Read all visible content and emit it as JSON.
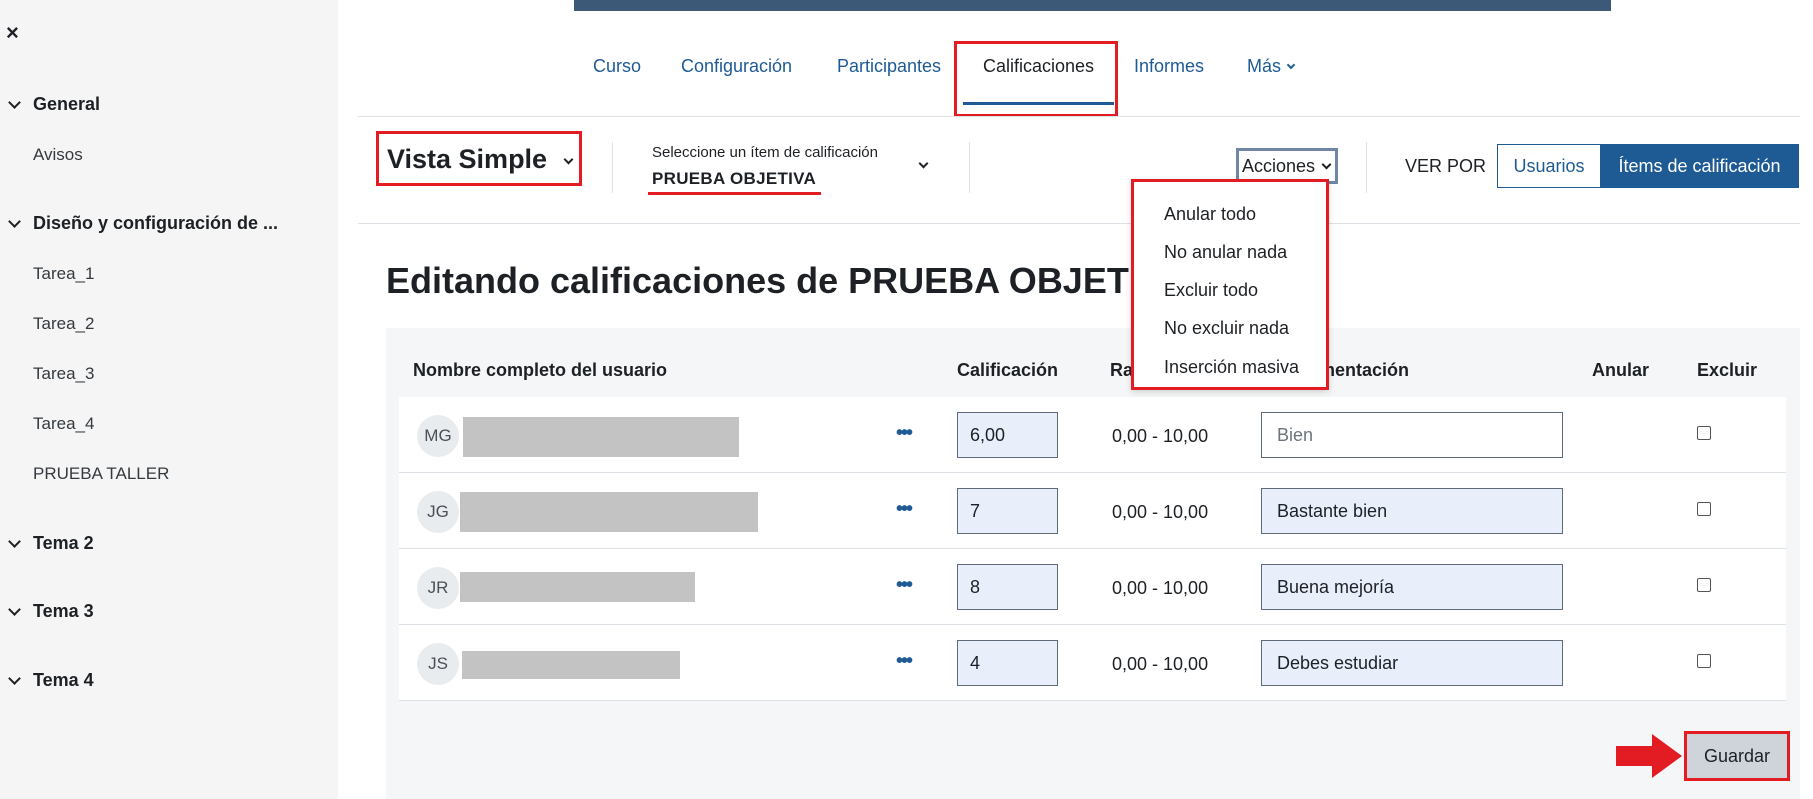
{
  "sidebar": {
    "close": "×",
    "sections": [
      {
        "title": "General",
        "items": [
          "Avisos"
        ]
      },
      {
        "title": "Diseño y configuración de ...",
        "items": [
          "Tarea_1",
          "Tarea_2",
          "Tarea_3",
          "Tarea_4",
          "PRUEBA TALLER"
        ]
      },
      {
        "title": "Tema 2",
        "items": []
      },
      {
        "title": "Tema 3",
        "items": []
      },
      {
        "title": "Tema 4",
        "items": []
      }
    ]
  },
  "nav": {
    "tabs": [
      "Curso",
      "Configuración",
      "Participantes",
      "Calificaciones",
      "Informes",
      "Más"
    ],
    "active": "Calificaciones"
  },
  "toolbar": {
    "view": "Vista Simple",
    "select_label": "Seleccione un ítem de calificación",
    "select_value": "PRUEBA OBJETIVA",
    "actions": "Acciones",
    "ver_por": "VER POR",
    "btn_users": "Usuarios",
    "btn_items": "Ítems de calificación"
  },
  "actions_menu": [
    "Anular todo",
    "No anular nada",
    "Excluir todo",
    "No excluir nada",
    "Inserción masiva"
  ],
  "page": {
    "title": "Editando calificaciones de PRUEBA OBJETI"
  },
  "table": {
    "headers": {
      "name": "Nombre completo del usuario",
      "grade": "Calificación",
      "range": "Ra",
      "feedback": "mentación",
      "override": "Anular",
      "exclude": "Excluir"
    },
    "rows": [
      {
        "initials": "MG",
        "grade": "6,00",
        "range": "0,00 - 10,00",
        "feedback": "Bien",
        "feedback_placeholder": true
      },
      {
        "initials": "JG",
        "grade": "7",
        "range": "0,00 - 10,00",
        "feedback": "Bastante bien",
        "feedback_placeholder": false
      },
      {
        "initials": "JR",
        "grade": "8",
        "range": "0,00 - 10,00",
        "feedback": "Buena mejoría",
        "feedback_placeholder": false
      },
      {
        "initials": "JS",
        "grade": "4",
        "range": "0,00 - 10,00",
        "feedback": "Debes estudiar",
        "feedback_placeholder": false
      }
    ]
  },
  "save_button": "Guardar",
  "colors": {
    "accent": "#1e5b94",
    "highlight": "#e31b23"
  }
}
